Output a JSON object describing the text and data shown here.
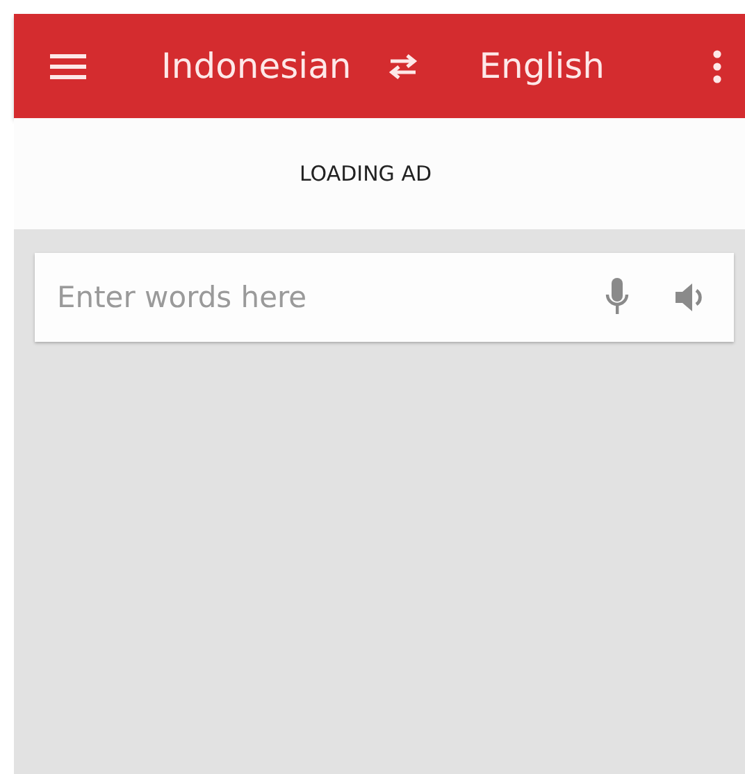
{
  "toolbar": {
    "source_language": "Indonesian",
    "target_language": "English"
  },
  "ad_banner": {
    "text": "LOADING AD"
  },
  "input": {
    "placeholder": "Enter words here"
  }
}
